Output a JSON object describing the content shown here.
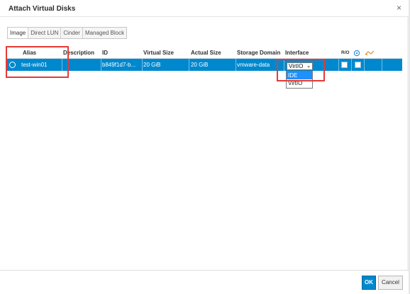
{
  "dialog": {
    "title": "Attach Virtual Disks",
    "close_glyph": "×"
  },
  "tabs": [
    {
      "label": "Image",
      "active": true
    },
    {
      "label": "Direct LUN",
      "active": false
    },
    {
      "label": "Cinder",
      "active": false
    },
    {
      "label": "Managed Block",
      "active": false
    }
  ],
  "table": {
    "columns": {
      "alias": "Alias",
      "description": "Description",
      "id": "ID",
      "virtual_size": "Virtual Size",
      "actual_size": "Actual Size",
      "storage_domain": "Storage Domain",
      "interface": "Interface",
      "ro": "R/O",
      "col_icon_1": "shared-disk-icon",
      "col_icon_2": "bootable-disk-icon"
    },
    "rows": [
      {
        "selected": true,
        "alias": "test-win01",
        "description": "",
        "id": "b849f1d7-b...",
        "virtual_size": "20 GiB",
        "actual_size": "20 GiB",
        "storage_domain": "vmware-data",
        "interface": "VirtIO",
        "ro_checked": false,
        "bootable_checked": false
      }
    ]
  },
  "interface_dropdown": {
    "selected": "VirtIO",
    "options": [
      "IDE",
      "VirtIO"
    ],
    "highlighted": "IDE"
  },
  "footer": {
    "ok_label": "OK",
    "cancel_label": "Cancel"
  },
  "colors": {
    "selected_row": "#0088ce",
    "primary_button": "#0088ce",
    "highlight_box": "#e53935"
  }
}
